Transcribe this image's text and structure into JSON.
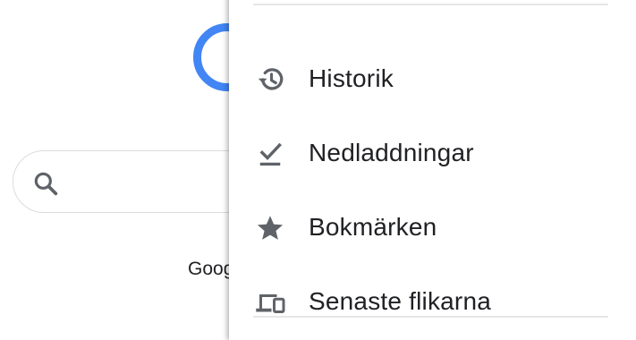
{
  "background": {
    "caption": "Goog",
    "search_icon": "search-icon",
    "logo_color": "#4285f4"
  },
  "menu": {
    "items": [
      {
        "label": "Historik",
        "icon": "history-icon"
      },
      {
        "label": "Nedladdningar",
        "icon": "download-done-icon"
      },
      {
        "label": "Bokmärken",
        "icon": "star-icon"
      },
      {
        "label": "Senaste flikarna",
        "icon": "devices-icon"
      }
    ],
    "icon_color": "#5f6368"
  }
}
